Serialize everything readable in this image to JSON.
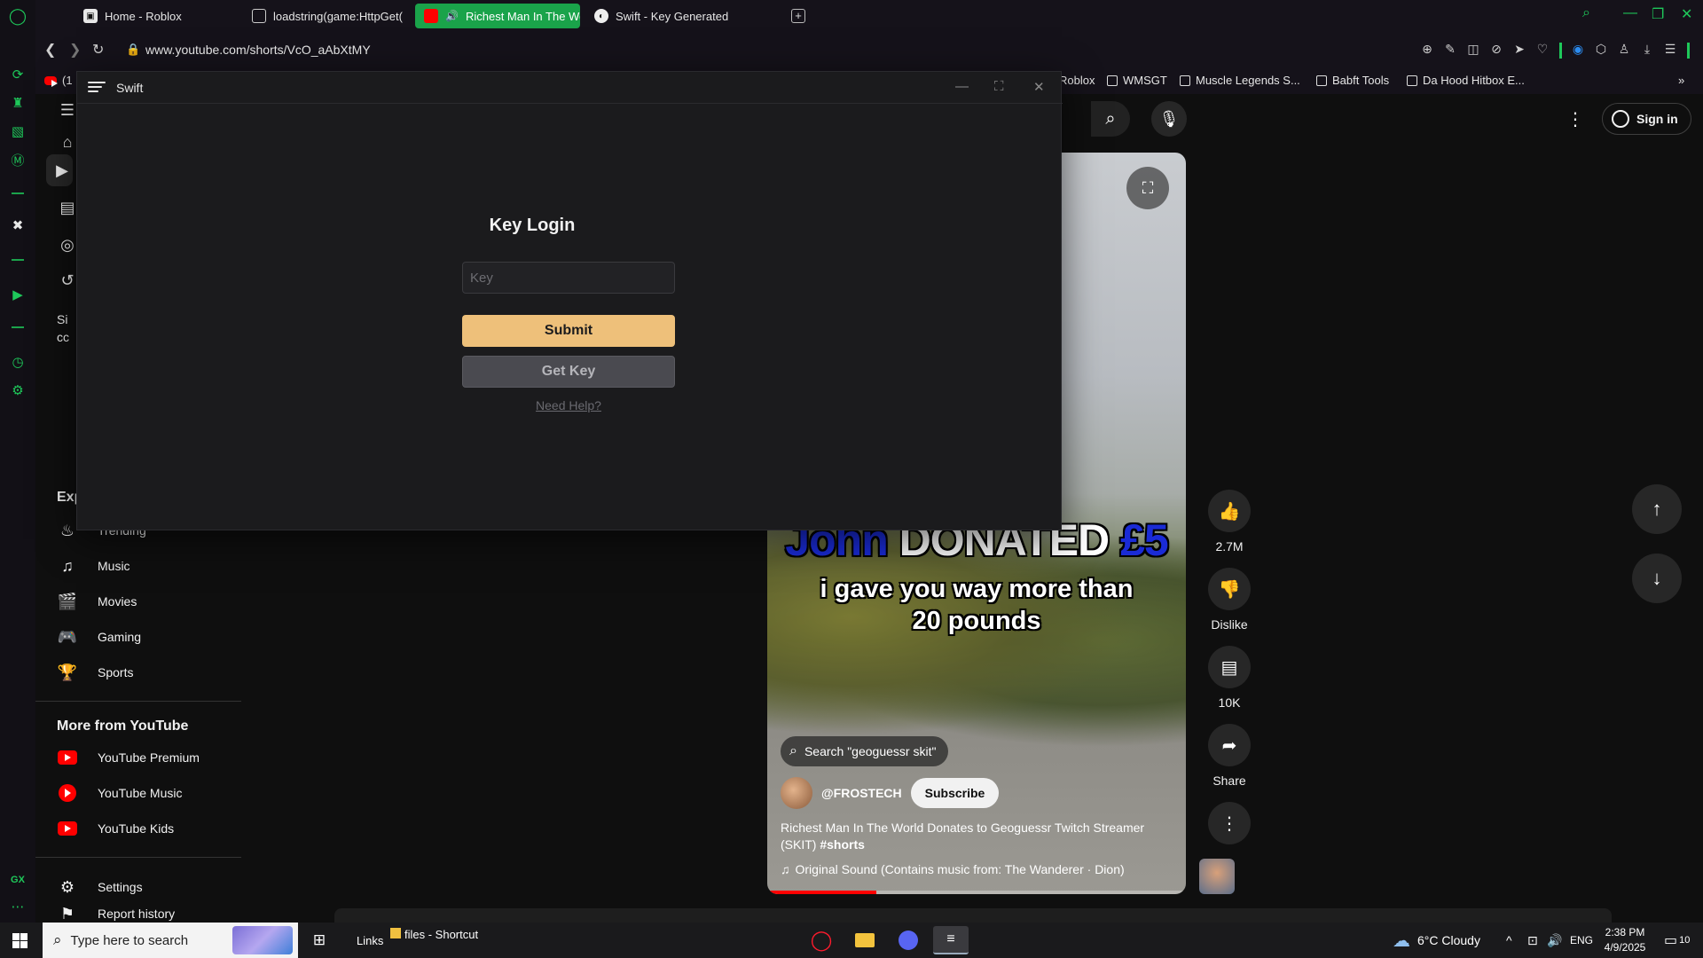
{
  "browser": {
    "tabs": [
      {
        "label": "Home - Roblox"
      },
      {
        "label": "loadstring(game:HttpGet("
      },
      {
        "label": "Richest Man In The Wo"
      },
      {
        "label": "Swift - Key Generated"
      }
    ],
    "url": "www.youtube.com/shorts/VcO_aAbXtMY",
    "bookmarks": [
      "Roblox",
      "WMSGT",
      "Muscle Legends S...",
      "Babft Tools",
      "Da Hood Hitbox E..."
    ],
    "bookmark_left_partial": "(1"
  },
  "swift": {
    "window_title": "Swift",
    "heading": "Key Login",
    "key_placeholder": "Key",
    "submit_label": "Submit",
    "get_key_label": "Get Key",
    "help_label": "Need Help?"
  },
  "youtube": {
    "sign_in": "Sign in",
    "sidebar": {
      "partial_texts": [
        "Si",
        "cc",
        "Exp",
        "Trending"
      ],
      "explore": [
        {
          "label": "Music"
        },
        {
          "label": "Movies"
        },
        {
          "label": "Gaming"
        },
        {
          "label": "Sports"
        }
      ],
      "more_heading": "More from YouTube",
      "more": [
        {
          "label": "YouTube Premium"
        },
        {
          "label": "YouTube Music"
        },
        {
          "label": "YouTube Kids"
        }
      ],
      "settings": "Settings",
      "report": "Report history"
    },
    "short": {
      "overlay_name": "John",
      "overlay_donated": "DONATED",
      "overlay_amount": "£5",
      "overlay_line2": "i gave you way more than",
      "overlay_line3": "20 pounds",
      "search_pill": "Search \"geoguessr skit\"",
      "channel": "@FROSTECH",
      "subscribe": "Subscribe",
      "title_text": "Richest Man In The World Donates to Geoguessr Twitch Streamer (SKIT)",
      "title_tag": "#shorts",
      "sound": "Original Sound (Contains music from: The Wanderer · Dion)",
      "progress": 0.26
    },
    "actions": {
      "likes": "2.7M",
      "dislike": "Dislike",
      "comments": "10K",
      "share": "Share"
    }
  },
  "taskbar": {
    "search_placeholder": "Type here to search",
    "links": "Links",
    "files_shortcut": "files - Shortcut",
    "weather": "6°C  Cloudy",
    "lang": "ENG",
    "time": "2:38 PM",
    "date": "4/9/2025",
    "notifications": "10"
  },
  "colors": {
    "gx_green": "#1ec85a",
    "submit": "#eec07a",
    "yt_red": "#ff0000"
  }
}
